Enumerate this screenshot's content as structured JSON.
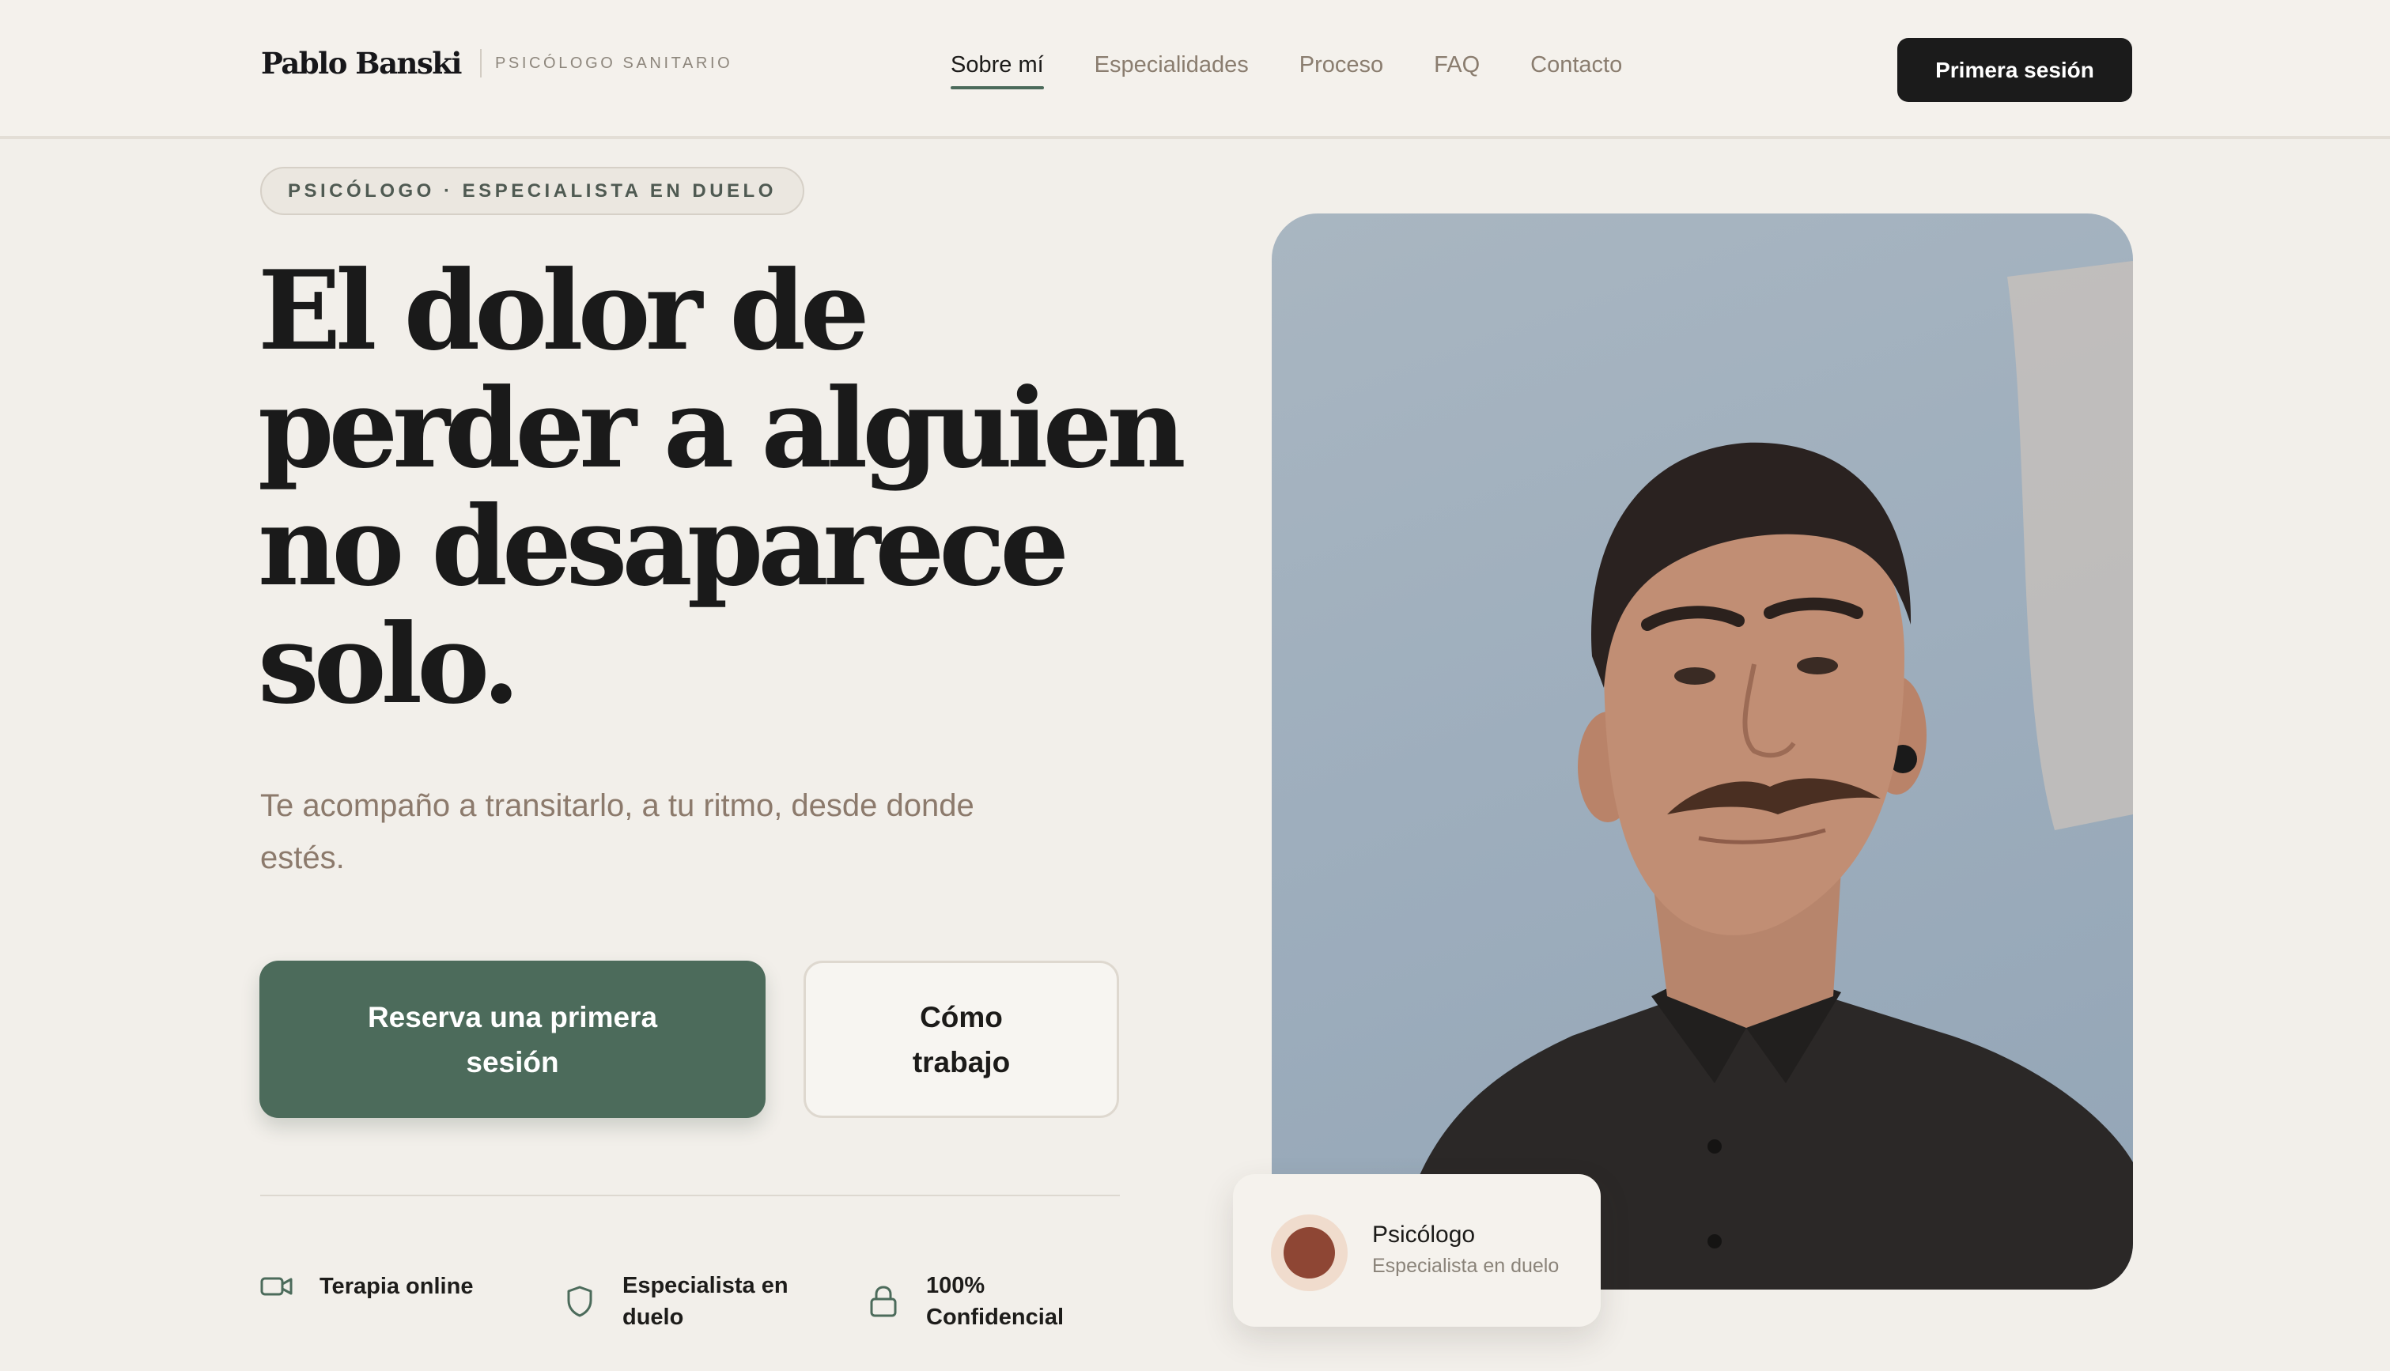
{
  "header": {
    "brand_name": "Pablo Banski",
    "brand_subtitle": "PSICÓLOGO SANITARIO",
    "nav": [
      {
        "label": "Sobre mí",
        "active": true
      },
      {
        "label": "Especialidades",
        "active": false
      },
      {
        "label": "Proceso",
        "active": false
      },
      {
        "label": "FAQ",
        "active": false
      },
      {
        "label": "Contacto",
        "active": false
      }
    ],
    "cta_label": "Primera sesión"
  },
  "hero": {
    "badge": "PSICÓLOGO · ESPECIALISTA EN DUELO",
    "headline_lines": [
      "El dolor de",
      "perder a alguien",
      "no desaparece",
      "solo."
    ],
    "subtitle": "Te acompaño a transitarlo, a tu ritmo, desde donde estés.",
    "primary_button": "Reserva una primera sesión",
    "secondary_button": "Cómo trabajo",
    "features": [
      {
        "icon": "video-camera-icon",
        "label": "Terapia online"
      },
      {
        "icon": "shield-icon",
        "label": "Especialista en duelo"
      },
      {
        "icon": "lock-icon",
        "label": "100% Confidencial"
      }
    ]
  },
  "profile_card": {
    "title": "Psicólogo",
    "subtitle": "Especialista en duelo"
  },
  "colors": {
    "accent_green": "#4c6b5b",
    "dark": "#1b1b1b",
    "background": "#f2efea",
    "muted_text": "#8c7a6c",
    "card_dot": "#8e4634"
  }
}
